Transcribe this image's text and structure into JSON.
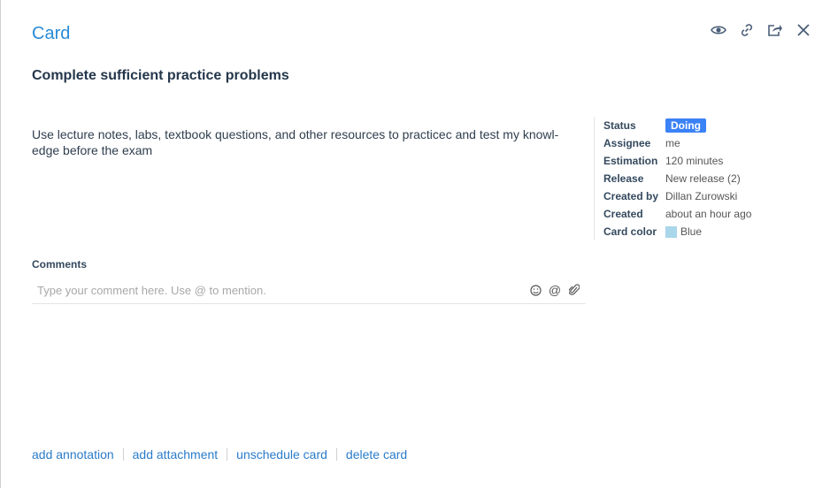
{
  "header": {
    "title": "Card"
  },
  "task": {
    "title": "Complete sufficient practice problems",
    "description": "Use lecture notes, labs, textbook questions, and other resources to practicec and test my knowl-\nedge before the exam"
  },
  "properties": {
    "status": {
      "label": "Status",
      "value": "Doing",
      "color": "#3b82f6"
    },
    "assignee": {
      "label": "Assignee",
      "value": "me"
    },
    "estimation": {
      "label": "Estimation",
      "value": "120 minutes"
    },
    "release": {
      "label": "Release",
      "value": "New release (2)"
    },
    "created_by": {
      "label": "Created by",
      "value": "Dillan Zurowski"
    },
    "created": {
      "label": "Created",
      "value": "about an hour ago"
    },
    "card_color": {
      "label": "Card color",
      "value": "Blue",
      "swatch": "#a9d6ea"
    }
  },
  "comments": {
    "label": "Comments",
    "placeholder": "Type your comment here. Use @ to mention.",
    "tools": [
      "emoji-icon",
      "mention-icon",
      "attach-icon"
    ]
  },
  "footer": {
    "add_annotation": "add annotation",
    "add_attachment": "add attachment",
    "unschedule_card": "unschedule card",
    "delete_card": "delete card"
  },
  "header_icons": [
    "eye-icon",
    "link-icon",
    "share-icon",
    "close-icon"
  ]
}
